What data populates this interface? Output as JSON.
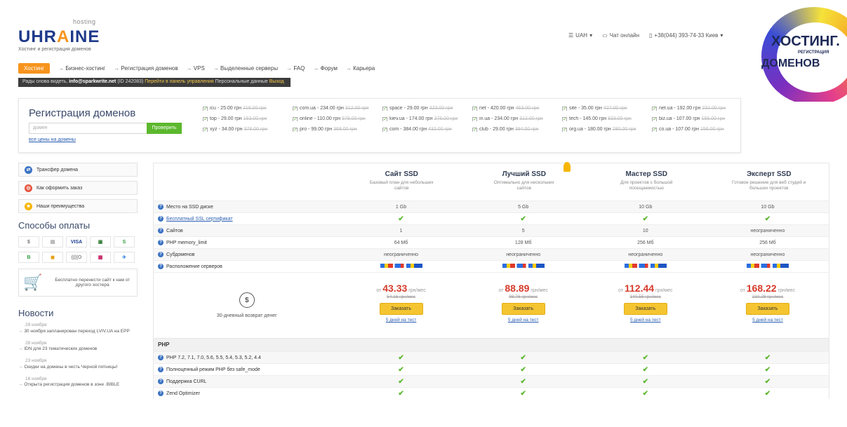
{
  "logo": {
    "hosting": "hosting",
    "word_a": "UHR",
    "word_o": "A",
    "word_b": "INE",
    "tagline": "Хостинг и регистрация доменов"
  },
  "top_right": {
    "currency": "UAH",
    "chat": "Чат онлайн",
    "phone": "+38(044) 393-74-33 Киев"
  },
  "banner": {
    "line1": "ХОСТИНГ.",
    "line2": "РЕГИСТРАЦИЯ",
    "line3": "ДОМЕНОВ"
  },
  "nav": {
    "active": "Хостинг",
    "items": [
      "Бизнес-хостинг",
      "Регистрация доменов",
      "VPS",
      "Выделенные серверы",
      "FAQ",
      "Форум",
      "Карьера"
    ]
  },
  "userbar": {
    "prefix": "Рады снова видеть,",
    "email": "info@sparkwrite.net",
    "id": "(ID 242083)",
    "panel": "Перейти в панель управления",
    "personal": "Персональные данные",
    "logout": "Выход"
  },
  "domain_reg": {
    "title": "Регистрация доменов",
    "placeholder": "домен",
    "button": "Проверить",
    "all_prices": "все цены на домены",
    "zones": [
      {
        "name": "icu",
        "price": "25.00 грн",
        "old": "216.00 грн"
      },
      {
        "name": "com.ua",
        "price": "234.00 грн",
        "old": "312.00 грн"
      },
      {
        "name": "space",
        "price": "29.00 грн",
        "old": "323.00 грн"
      },
      {
        "name": "net",
        "price": "420.00 грн",
        "old": "463.00 грн"
      },
      {
        "name": "site",
        "price": "35.00 грн",
        "old": "427.00 грн"
      },
      {
        "name": "net.ua",
        "price": "192.00 грн",
        "old": "232.00 грн"
      },
      {
        "name": "top",
        "price": "29.00 грн",
        "old": "163.00 грн"
      },
      {
        "name": "online",
        "price": "110.00 грн",
        "old": "578.00 грн"
      },
      {
        "name": "kiev.ua",
        "price": "174.00 грн",
        "old": "276.00 грн"
      },
      {
        "name": "in.ua",
        "price": "234.00 грн",
        "old": "312.00 грн"
      },
      {
        "name": "tech",
        "price": "145.00 грн",
        "old": "833.00 грн"
      },
      {
        "name": "biz.ua",
        "price": "107.00 грн",
        "old": "156.00 грн"
      },
      {
        "name": "xyz",
        "price": "34.00 грн",
        "old": "378.00 грн"
      },
      {
        "name": "pro",
        "price": "99.00 грн",
        "old": "368.00 грн"
      },
      {
        "name": "com",
        "price": "384.00 грн",
        "old": "432.00 грн"
      },
      {
        "name": "club",
        "price": "29.00 грн",
        "old": "384.00 грн"
      },
      {
        "name": "org.ua",
        "price": "180.00 грн",
        "old": "280.00 грн"
      },
      {
        "name": "co.ua",
        "price": "107.00 грн",
        "old": "156.00 грн"
      }
    ]
  },
  "sidebar": {
    "buttons": [
      "Трансфер домена",
      "Как оформить заказ",
      "Наши преимущества"
    ],
    "payments_title": "Способы оплаты",
    "payments": [
      "$",
      "▤",
      "VISA",
      "▣",
      "S",
      "B",
      "◼",
      "((((O",
      "▦",
      "✈"
    ],
    "transfer_text": "Бесплатно перенести сайт к нам от другого хостера",
    "news_title": "Новости",
    "news": [
      {
        "date": "29 ноября",
        "text": "30 ноября запланирован переход LVIV.UA на EPP"
      },
      {
        "date": "28 ноября",
        "text": "IDN для 23 тематических доменов"
      },
      {
        "date": "23 ноября",
        "text": "Скидки на домены в честь Черной пятницы!"
      },
      {
        "date": "16 ноября",
        "text": "Открыта регистрация доменов в зоне .BIBLE"
      }
    ]
  },
  "plans": [
    {
      "name": "Сайт SSD",
      "desc": "Базовый план для небольших сайтов",
      "price": "43.33",
      "old": "54.16 грн/мес"
    },
    {
      "name": "Лучший SSD",
      "desc": "Оптимально для нескольких сайтов",
      "price": "88.89",
      "old": "98.76 грн/мес"
    },
    {
      "name": "Мастер SSD",
      "desc": "Для проектов с большой посещаемостью",
      "price": "112.44",
      "old": "140.55 грн/мес"
    },
    {
      "name": "Эксперт SSD",
      "desc": "Готовое решение для веб студий и больших проектов",
      "price": "168.22",
      "old": "210.28 грн/мес"
    }
  ],
  "price_labels": {
    "from": "от",
    "unit": "грн/мес",
    "order": "Заказать",
    "test": "5 дней на тест",
    "refund": "30-дневный возврат денег"
  },
  "features": [
    {
      "label": "Место на SSD диске",
      "values": [
        "1 Gb",
        "5 Gb",
        "10 Gb",
        "10 Gb"
      ]
    },
    {
      "label": "Бесплатный SSL сертификат",
      "values": [
        "✔",
        "✔",
        "✔",
        "✔"
      ],
      "link": true
    },
    {
      "label": "Сайтов",
      "values": [
        "1",
        "5",
        "10",
        "неограниченно"
      ]
    },
    {
      "label": "PHP memory_limit",
      "values": [
        "64 Мб",
        "128 Мб",
        "256 Мб",
        "256 Мб"
      ]
    },
    {
      "label": "Субдоменов",
      "values": [
        "неограниченно",
        "неограниченно",
        "неограниченно",
        "неограниченно"
      ]
    },
    {
      "label": "Расположение серверов",
      "values": [
        "flags",
        "flags",
        "flags",
        "flags"
      ]
    }
  ],
  "php_section": "PHP",
  "php_features": [
    {
      "label": "PHP 7.2, 7.1, 7.0, 5.6, 5.5, 5.4, 5.3, 5.2, 4.4",
      "values": [
        "✔",
        "✔",
        "✔",
        "✔"
      ]
    },
    {
      "label": "Полноценный режим PHP без safe_mode",
      "values": [
        "✔",
        "✔",
        "✔",
        "✔"
      ]
    },
    {
      "label": "Поддержка CURL",
      "values": [
        "✔",
        "✔",
        "✔",
        "✔"
      ]
    },
    {
      "label": "Zend Optimizer",
      "values": [
        "✔",
        "✔",
        "✔",
        "✔"
      ]
    }
  ],
  "colors": {
    "accent": "#f7941d",
    "link": "#2a5db0",
    "check": "#5cb82e",
    "price": "#d63b2b",
    "order": "#f5c531"
  }
}
